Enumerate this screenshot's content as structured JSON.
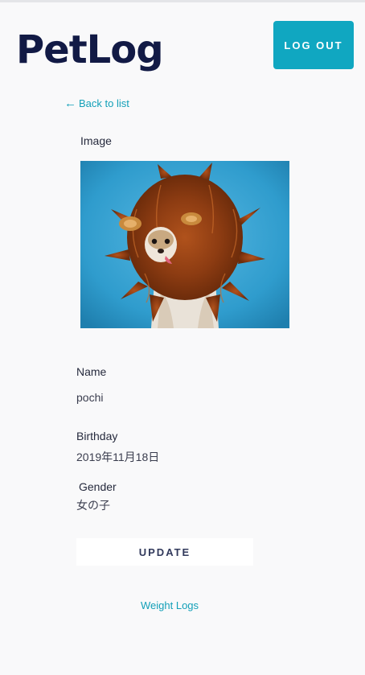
{
  "header": {
    "logo": "PetLog",
    "logout_label": "LOG OUT"
  },
  "nav": {
    "back_label": "Back to list",
    "back_icon": "arrow-left-icon"
  },
  "pet": {
    "image_label": "Image",
    "name_label": "Name",
    "name_value": "pochi",
    "birthday_label": "Birthday",
    "birthday_value": "2019年11月18日",
    "gender_label": "Gender",
    "gender_value": "女の子"
  },
  "actions": {
    "update_label": "UPDATE",
    "weight_logs_label": "Weight Logs"
  },
  "colors": {
    "accent": "#10a7c1",
    "logo": "#121a45",
    "background": "#f9f9fa"
  }
}
